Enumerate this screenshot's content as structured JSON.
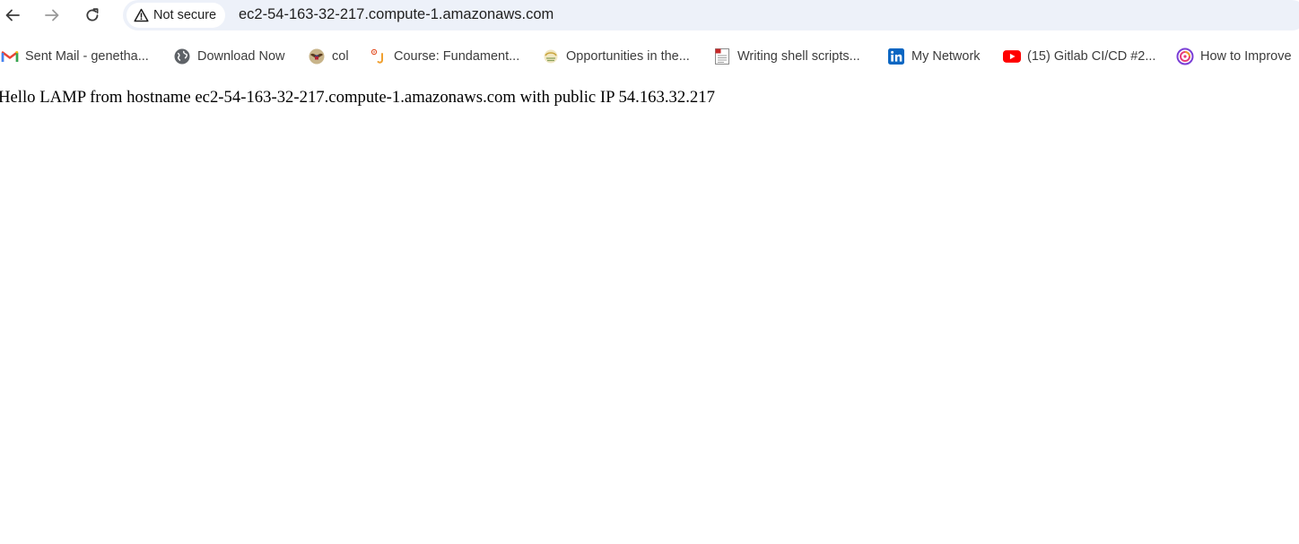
{
  "browser": {
    "security_label": "Not secure",
    "url": "ec2-54-163-32-217.compute-1.amazonaws.com",
    "nav": {
      "back_icon": "arrow-left-icon",
      "forward_icon": "arrow-right-icon",
      "reload_icon": "reload-icon"
    }
  },
  "bookmarks": [
    {
      "label": "Sent Mail - genetha...",
      "icon": "gmail-icon"
    },
    {
      "label": "Download Now",
      "icon": "globe-icon"
    },
    {
      "label": "col",
      "icon": "seal-icon"
    },
    {
      "label": "Course: Fundament...",
      "icon": "course-icon"
    },
    {
      "label": "Opportunities in the...",
      "icon": "emblem-icon"
    },
    {
      "label": "Writing shell scripts...",
      "icon": "document-icon"
    },
    {
      "label": "My Network",
      "icon": "linkedin-icon"
    },
    {
      "label": "(15) Gitlab CI/CD #2...",
      "icon": "youtube-icon"
    },
    {
      "label": "How to Improve",
      "icon": "swirl-icon"
    }
  ],
  "page": {
    "text": "Hello LAMP from hostname ec2-54-163-32-217.compute-1.amazonaws.com with public IP 54.163.32.217"
  },
  "colors": {
    "omnibox_bg": "#edf1f9",
    "gmail_red": "#ea4335",
    "linkedin_blue": "#0a66c2",
    "youtube_red": "#ff0000"
  }
}
